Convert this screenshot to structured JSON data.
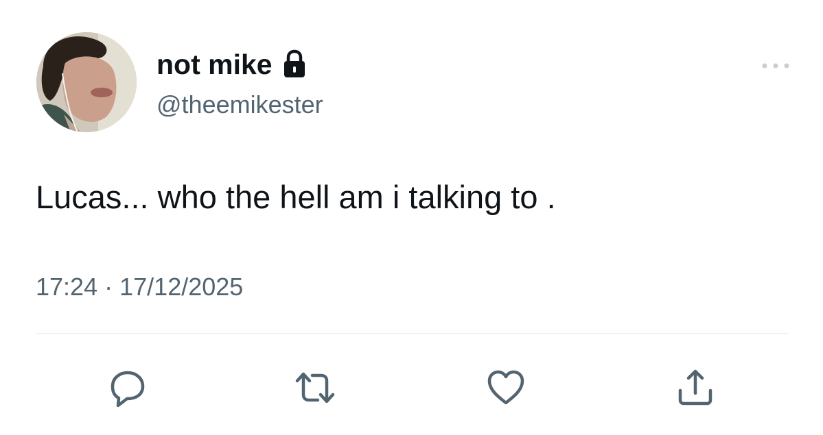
{
  "user": {
    "display_name": "not mike",
    "handle": "@theemikester",
    "protected_icon": "lock-icon",
    "avatar": "profile-photo"
  },
  "tweet": {
    "text": "Lucas... who the hell am i talking to .",
    "time": "17:24",
    "separator": "·",
    "date": "17/12/2025"
  },
  "actions": [
    {
      "name": "reply",
      "icon": "speech-bubble-icon"
    },
    {
      "name": "retweet",
      "icon": "retweet-arrows-icon"
    },
    {
      "name": "like",
      "icon": "heart-icon"
    },
    {
      "name": "share",
      "icon": "share-upload-icon"
    }
  ],
  "menu": {
    "icon": "more-dots-icon"
  },
  "colors": {
    "text_primary": "#0f1419",
    "text_secondary": "#536471",
    "icon_color": "#536471",
    "divider": "#e6ecf0",
    "background": "#ffffff"
  }
}
